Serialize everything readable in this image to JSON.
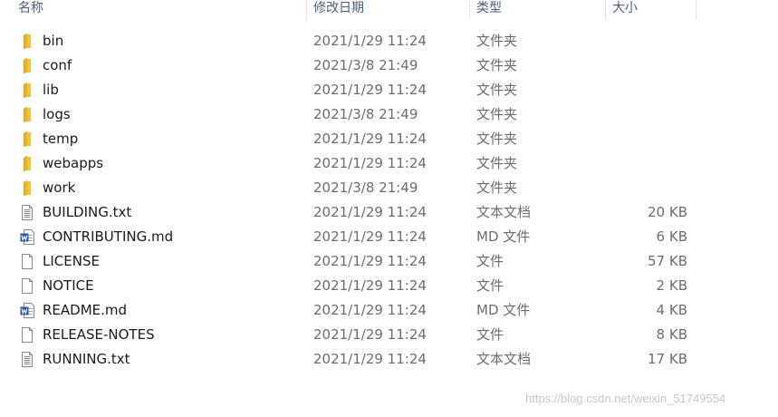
{
  "columns": {
    "name": "名称",
    "date": "修改日期",
    "type": "类型",
    "size": "大小"
  },
  "rows": [
    {
      "name": "bin",
      "date": "2021/1/29 11:24",
      "type": "文件夹",
      "size": "",
      "icon": "folder-icon"
    },
    {
      "name": "conf",
      "date": "2021/3/8 21:49",
      "type": "文件夹",
      "size": "",
      "icon": "folder-icon"
    },
    {
      "name": "lib",
      "date": "2021/1/29 11:24",
      "type": "文件夹",
      "size": "",
      "icon": "folder-icon"
    },
    {
      "name": "logs",
      "date": "2021/3/8 21:49",
      "type": "文件夹",
      "size": "",
      "icon": "folder-icon"
    },
    {
      "name": "temp",
      "date": "2021/1/29 11:24",
      "type": "文件夹",
      "size": "",
      "icon": "folder-icon"
    },
    {
      "name": "webapps",
      "date": "2021/1/29 11:24",
      "type": "文件夹",
      "size": "",
      "icon": "folder-icon"
    },
    {
      "name": "work",
      "date": "2021/3/8 21:49",
      "type": "文件夹",
      "size": "",
      "icon": "folder-icon"
    },
    {
      "name": "BUILDING.txt",
      "date": "2021/1/29 11:24",
      "type": "文本文档",
      "size": "20 KB",
      "icon": "text-file-icon"
    },
    {
      "name": "CONTRIBUTING.md",
      "date": "2021/1/29 11:24",
      "type": "MD 文件",
      "size": "6 KB",
      "icon": "word-document-icon"
    },
    {
      "name": "LICENSE",
      "date": "2021/1/29 11:24",
      "type": "文件",
      "size": "57 KB",
      "icon": "blank-file-icon"
    },
    {
      "name": "NOTICE",
      "date": "2021/1/29 11:24",
      "type": "文件",
      "size": "2 KB",
      "icon": "blank-file-icon"
    },
    {
      "name": "README.md",
      "date": "2021/1/29 11:24",
      "type": "MD 文件",
      "size": "4 KB",
      "icon": "word-document-icon"
    },
    {
      "name": "RELEASE-NOTES",
      "date": "2021/1/29 11:24",
      "type": "文件",
      "size": "8 KB",
      "icon": "blank-file-icon"
    },
    {
      "name": "RUNNING.txt",
      "date": "2021/1/29 11:24",
      "type": "文本文档",
      "size": "17 KB",
      "icon": "text-file-icon"
    }
  ],
  "watermark": "https://blog.csdn.net/weixin_51749554",
  "colors": {
    "folder": "#f3c33b",
    "word": "#2b579a",
    "header_text": "#4c607a"
  }
}
